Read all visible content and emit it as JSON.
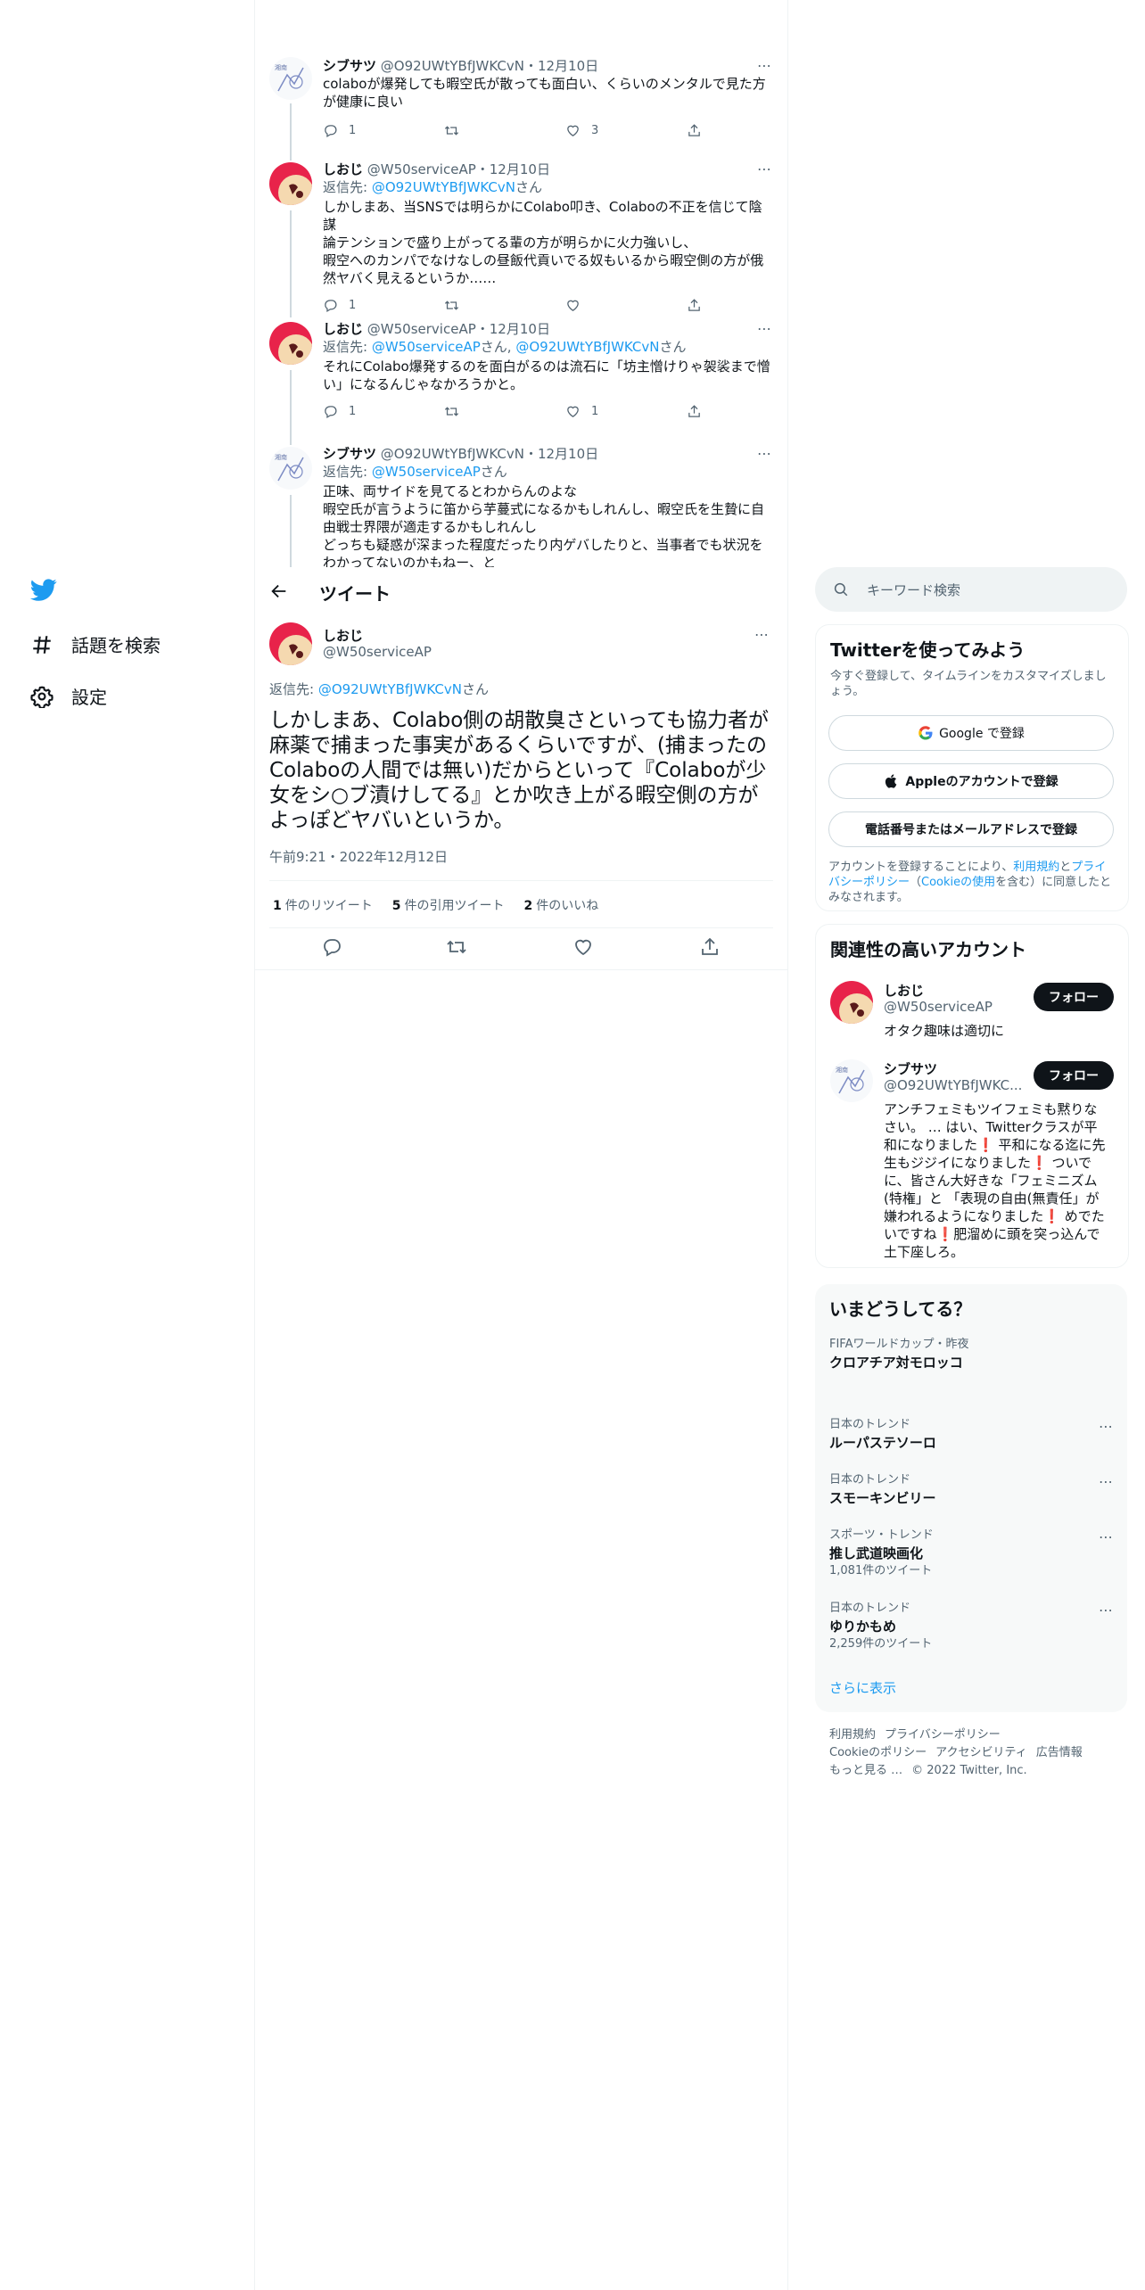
{
  "sidebar": {
    "logo": "twitter-bird-icon",
    "items": [
      {
        "label": "話題を検索",
        "icon": "hashtag-icon"
      },
      {
        "label": "設定",
        "icon": "gear-icon"
      }
    ]
  },
  "thread": [
    {
      "name": "シブサツ",
      "handle": "@O92UWtYBfJWKCvN",
      "date": "・12月10日",
      "reply_prefix": "",
      "reply_to": [],
      "reply_suffix": "",
      "text": "colaboが爆発しても暇空氏が散っても面白い、くらいのメンタルで見た方\nが健康に良い",
      "counts": {
        "reply": "1",
        "retweet": "",
        "like": "3"
      }
    },
    {
      "name": "しおじ",
      "handle": "@W50serviceAP",
      "date": "・12月10日",
      "reply_prefix": "返信先: ",
      "reply_to": [
        "@O92UWtYBfJWKCvN"
      ],
      "reply_suffix": "さん",
      "text": "しかしまあ、当SNSでは明らかにColabo叩き、Colaboの不正を信じて陰謀\n論テンションで盛り上がってる輩の方が明らかに火力強いし、\n暇空へのカンパでなけなしの昼飯代貢いでる奴もいるから暇空側の方が俄\n然ヤバく見えるというか……",
      "counts": {
        "reply": "1",
        "retweet": "",
        "like": ""
      }
    },
    {
      "name": "しおじ",
      "handle": "@W50serviceAP",
      "date": "・12月10日",
      "reply_prefix": "返信先: ",
      "reply_to": [
        "@W50serviceAP",
        "@O92UWtYBfJWKCvN"
      ],
      "reply_suffix": "さん",
      "text": "それにColabo爆発するのを面白がるのは流石に「坊主憎けりゃ袈裟まで憎\nい」になるんじゃなかろうかと。",
      "counts": {
        "reply": "1",
        "retweet": "",
        "like": "1"
      }
    },
    {
      "name": "シブサツ",
      "handle": "@O92UWtYBfJWKCvN",
      "date": "・12月10日",
      "reply_prefix": "返信先: ",
      "reply_to": [
        "@W50serviceAP"
      ],
      "reply_suffix": "さん",
      "text": "正味、両サイドを見てるとわからんのよな\n暇空氏が言うように笛から芋蔓式になるかもしれんし、暇空氏を生贄に自\n由戦士界隈が適走するかもしれんし\nどっちも疑惑が深まった程度だったり内ゲバしたりと、当事者でも状況を\nわかってないのかもねー、と",
      "counts": {
        "reply": "",
        "retweet": "",
        "like": ""
      }
    }
  ],
  "header": {
    "back_icon": "back-arrow-icon",
    "title": "ツイート"
  },
  "focal": {
    "name": "しおじ",
    "handle": "@W50serviceAP",
    "reply_prefix": "返信先: ",
    "reply_to": "@O92UWtYBfJWKCvN",
    "reply_suffix": "さん",
    "text": "しかしまあ、Colabo側の胡散臭さといっても協力者が麻薬で捕まった事実があるくらいですが、(捕まったのColaboの人間では無い)だからといって『Colaboが少女をシ○ブ漬けしてる』とか吹き上がる暇空側の方がよっぽどヤバいというか。",
    "time": "午前9:21・2022年12月12日",
    "stats": [
      {
        "count": "1",
        "label": "件のリツイート"
      },
      {
        "count": "5",
        "label": "件の引用ツイート"
      },
      {
        "count": "2",
        "label": "件のいいね"
      }
    ]
  },
  "right": {
    "search_placeholder": "キーワード検索",
    "signup": {
      "title": "Twitterを使ってみよう",
      "subtitle": "今すぐ登録して、タイムラインをカスタマイズしましょう。",
      "google_button": "Google で登録",
      "apple_button": "Appleのアカウントで登録",
      "phone_button": "電話番号またはメールアドレスで登録",
      "legal_prefix": "アカウントを登録することにより、",
      "terms_link": "利用規約",
      "legal_and": "と",
      "privacy_link": "プライバシーポリシー",
      "legal_paren_open": "（",
      "cookie_link": "Cookieの使用",
      "legal_suffix": "を含む）に同意したとみなされます。"
    },
    "related": {
      "title": "関連性の高いアカウント",
      "accounts": [
        {
          "name": "しおじ",
          "handle": "@W50serviceAP",
          "bio": "オタク趣味は適切に",
          "follow": "フォロー"
        },
        {
          "name": "シブサツ",
          "handle": "@O92UWtYBfJWKC...",
          "bio": "アンチフェミもツイフェミも黙りなさい。 … はい、Twitterクラスが平和になりました❗ 平和になる迄に先生もジジイになりました❗ ついでに、皆さん大好きな「フェミニズム(特権」と 「表現の自由(無責任」が嫌われるようになりました❗ めでたいですね❗肥溜めに頭を突っ込んで土下座しろ。",
          "follow": "フォロー"
        }
      ]
    },
    "trends": {
      "title": "いまどうしてる？",
      "items": [
        {
          "category": "FIFAワールドカップ・昨夜",
          "name": "クロアチア対モロッコ",
          "count": ""
        },
        {
          "category": "日本のトレンド",
          "name": "ルーパステソーロ",
          "count": ""
        },
        {
          "category": "日本のトレンド",
          "name": "スモーキンビリー",
          "count": ""
        },
        {
          "category": "スポーツ・トレンド",
          "name": "推し武道映画化",
          "count": "1,081件のツイート"
        },
        {
          "category": "日本のトレンド",
          "name": "ゆりかもめ",
          "count": "2,259件のツイート"
        }
      ],
      "show_more": "さらに表示"
    },
    "footer": {
      "line1": [
        "利用規約",
        "プライバシーポリシー"
      ],
      "line2": [
        "Cookieのポリシー",
        "アクセシビリティ",
        "広告情報"
      ],
      "line3": [
        "もっと見る …",
        "© 2022 Twitter, Inc."
      ]
    }
  },
  "colors": {
    "accent": "#1d9bf0",
    "text": "#0f1419",
    "muted": "#536471",
    "border": "#eff3f4"
  }
}
